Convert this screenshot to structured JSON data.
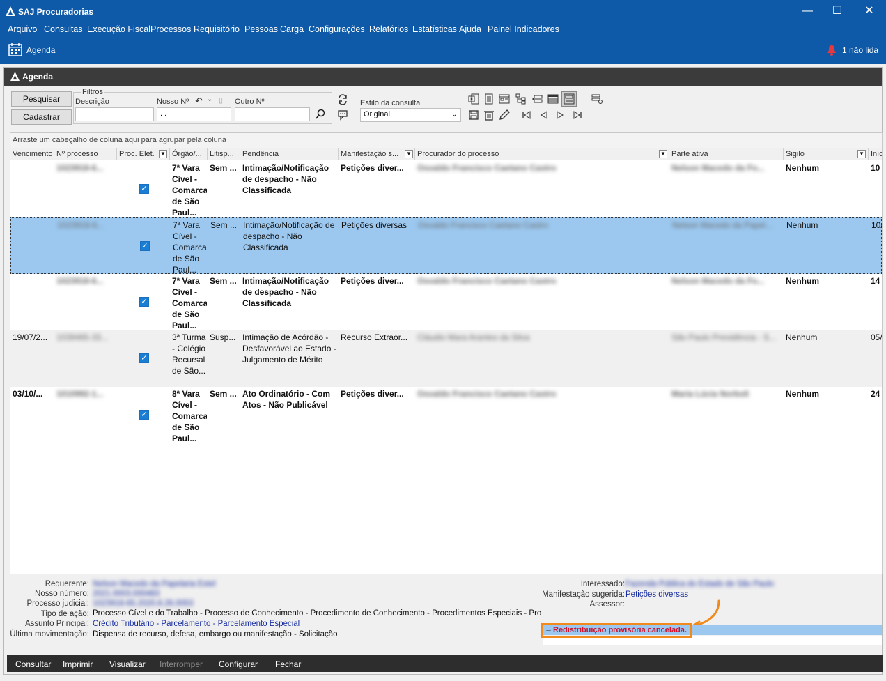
{
  "window": {
    "title": "SAJ Procuradorias",
    "minimize": "—",
    "maximize": "☐",
    "close": "✕"
  },
  "menu": [
    "Arquivo",
    "Consultas",
    "Execução Fiscal",
    "Processos",
    "Requisitório",
    "Pessoas",
    "Carga",
    "Configurações",
    "Relatórios",
    "Estatísticas",
    "Ajuda",
    "Painel Indicadores"
  ],
  "toolbar": {
    "agenda_label": "Agenda",
    "unread_label": "1 não lida"
  },
  "panel": {
    "title": "Agenda"
  },
  "search": {
    "pesquisar": "Pesquisar",
    "cadastrar": "Cadastrar",
    "filtros": "Filtros",
    "descricao_label": "Descrição",
    "nosso_label": "Nosso Nº",
    "nosso_value": ". .",
    "outro_label": "Outro Nº",
    "estilo_label": "Estilo da consulta",
    "estilo_value": "Original"
  },
  "grid": {
    "group_hint": "Arraste um cabeçalho de coluna aqui para agrupar pela coluna",
    "headers": [
      "Vencimento",
      "Nº processo",
      "Proc. Elet.",
      "Órgão/...",
      "Litisp...",
      "Pendência",
      "Manifestação s...",
      "Procurador do processo",
      "Parte ativa",
      "Sigilo",
      "Iníc"
    ],
    "rows": [
      {
        "venc": "",
        "proc": "1023918-6...",
        "orgao": "7ª Vara Cível - Comarca de São Paul...",
        "litisp": "Sem ...",
        "pend": "Intimação/Notificação de despacho - Não Classificada",
        "manif": "Petições diver...",
        "procurador": "Osvaldo Francisco Caetano Castro",
        "parte": "Nelson Macedo da Fo...",
        "sigilo": "Nenhum",
        "inic": "10"
      },
      {
        "venc": "",
        "proc": "1023918-6...",
        "orgao": "7ª Vara Cível - Comarca de São Paul...",
        "litisp": "Sem ...",
        "pend": "Intimação/Notificação de despacho - Não Classificada",
        "manif": "Petições diversas",
        "procurador": "Osvaldo Francisco Caetano Castro",
        "parte": "Nelson Macedo da Papel...",
        "sigilo": "Nenhum",
        "inic": "10/"
      },
      {
        "venc": "",
        "proc": "1023918-6...",
        "orgao": "7ª Vara Cível - Comarca de São Paul...",
        "litisp": "Sem ...",
        "pend": "Intimação/Notificação de despacho - Não Classificada",
        "manif": "Petições diver...",
        "procurador": "Osvaldo Francisco Caetano Castro",
        "parte": "Nelson Macedo da Fo...",
        "sigilo": "Nenhum",
        "inic": "14"
      },
      {
        "venc": "19/07/2...",
        "proc": "1039465-33...",
        "orgao": "3ª Turma - Colégio Recursal de São...",
        "litisp": "Susp...",
        "pend": "Intimação de Acórdão - Desfavorável ao Estado - Julgamento de Mérito",
        "manif": "Recurso Extraor...",
        "procurador": "Cláudio Mara Arantes da Silva",
        "parte": "São Paulo Previdência - S...",
        "sigilo": "Nenhum",
        "inic": "05/"
      },
      {
        "venc": "03/10/...",
        "proc": "1010992-1...",
        "orgao": "8ª Vara Cível - Comarca de São Paul...",
        "litisp": "Sem ...",
        "pend": "Ato Ordinatório - Com Atos - Não Publicável",
        "manif": "Petições diver...",
        "procurador": "Osvaldo Francisco Caetano Castro",
        "parte": "Maria Lúcia Norboli",
        "sigilo": "Nenhum",
        "inic": "24"
      }
    ]
  },
  "details": {
    "requerente_label": "Requerente:",
    "requerente_value": "Nelson Macedo da Papelaria Estel",
    "nosso_label": "Nosso número:",
    "nosso_value": "2021.0003.000483",
    "judicial_label": "Processo judicial:",
    "judicial_value": "1023918-65.2020.8.26.0053",
    "tipo_label": "Tipo de ação:",
    "tipo_value": "Processo Cível e do Trabalho - Processo de Conhecimento - Procedimento de Conhecimento - Procedimentos Especiais - Proced",
    "assunto_label": "Assunto Principal:",
    "assunto_value": "Crédito Tributário - Parcelamento - Parcelamento Especial",
    "ultima_label": "Última movimentação:",
    "ultima_value": "Dispensa de recurso, defesa, embargo ou manifestação - Solicitação",
    "interessado_label": "Interessado:",
    "interessado_value": "Fazenda Pública do Estado de São Paulo",
    "manif_label": "Manifestação sugerida:",
    "manif_value": "Petições diversas",
    "assessor_label": "Assessor:"
  },
  "notice": {
    "arrow": "→",
    "text": "Redistribuição provisória cancelada."
  },
  "footer": [
    "Consultar",
    "Imprimir",
    "Visualizar",
    "Interromper",
    "Configurar",
    "Fechar"
  ]
}
